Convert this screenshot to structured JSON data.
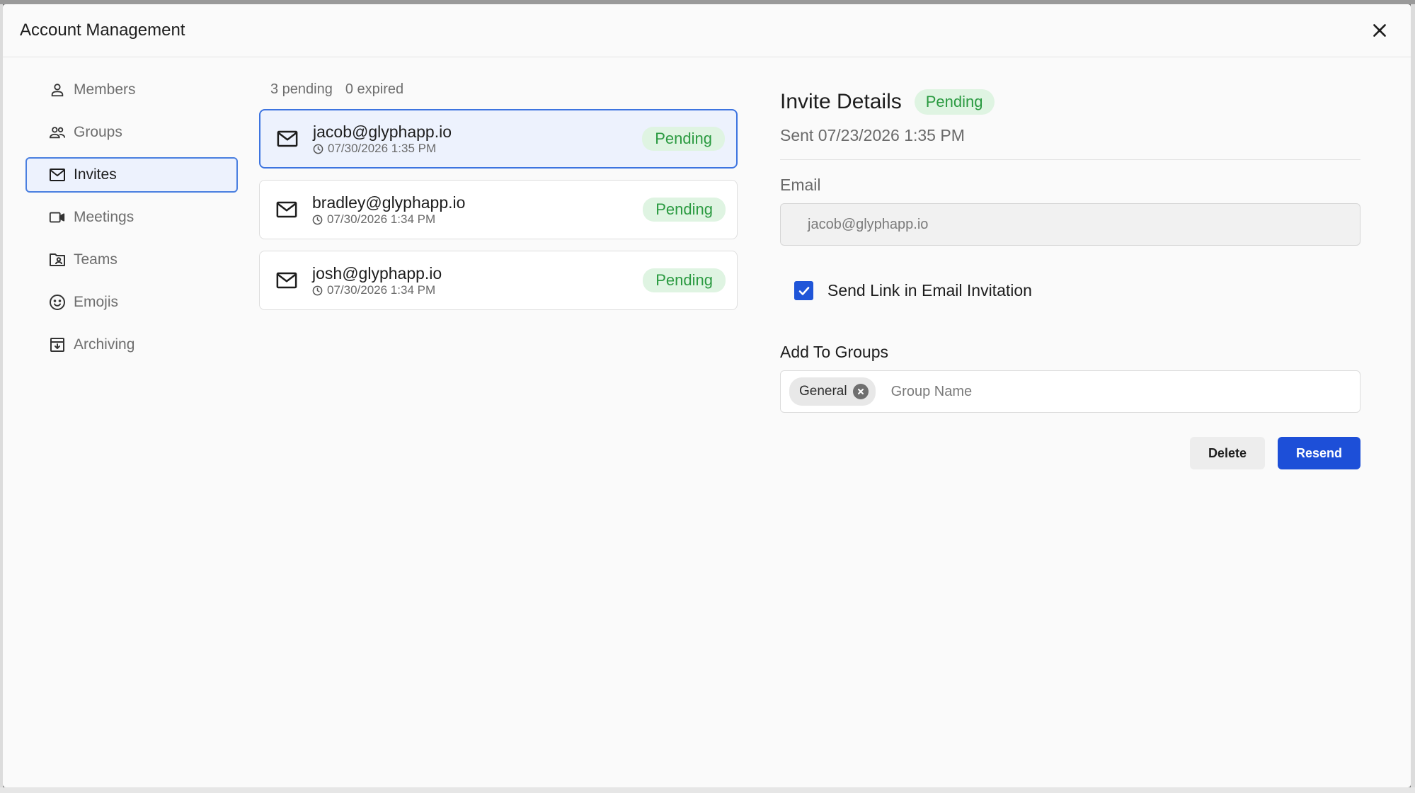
{
  "modal": {
    "title": "Account Management"
  },
  "sidebar": {
    "items": [
      {
        "label": "Members",
        "icon": "person-icon"
      },
      {
        "label": "Groups",
        "icon": "people-icon"
      },
      {
        "label": "Invites",
        "icon": "envelope-icon",
        "active": true
      },
      {
        "label": "Meetings",
        "icon": "video-icon"
      },
      {
        "label": "Teams",
        "icon": "folder-person-icon"
      },
      {
        "label": "Emojis",
        "icon": "smiley-icon"
      },
      {
        "label": "Archiving",
        "icon": "archive-icon"
      }
    ]
  },
  "invites": {
    "pending_count": "3 pending",
    "expired_count": "0 expired",
    "list": [
      {
        "email": "jacob@glyphapp.io",
        "time": "07/30/2026 1:35 PM",
        "status": "Pending",
        "selected": true
      },
      {
        "email": "bradley@glyphapp.io",
        "time": "07/30/2026 1:34 PM",
        "status": "Pending"
      },
      {
        "email": "josh@glyphapp.io",
        "time": "07/30/2026 1:34 PM",
        "status": "Pending"
      }
    ]
  },
  "details": {
    "title": "Invite Details",
    "status": "Pending",
    "sent": "Sent 07/23/2026 1:35 PM",
    "email_label": "Email",
    "email_value": "jacob@glyphapp.io",
    "checkbox_label": "Send Link in Email Invitation",
    "checkbox_checked": true,
    "groups_label": "Add To Groups",
    "group_chip": "General",
    "group_placeholder": "Group Name",
    "delete_label": "Delete",
    "resend_label": "Resend"
  },
  "colors": {
    "accent": "#1d4fd8",
    "selected_border": "#3d74e0",
    "pending_bg": "#dff4e2",
    "pending_text": "#2a9a40"
  }
}
